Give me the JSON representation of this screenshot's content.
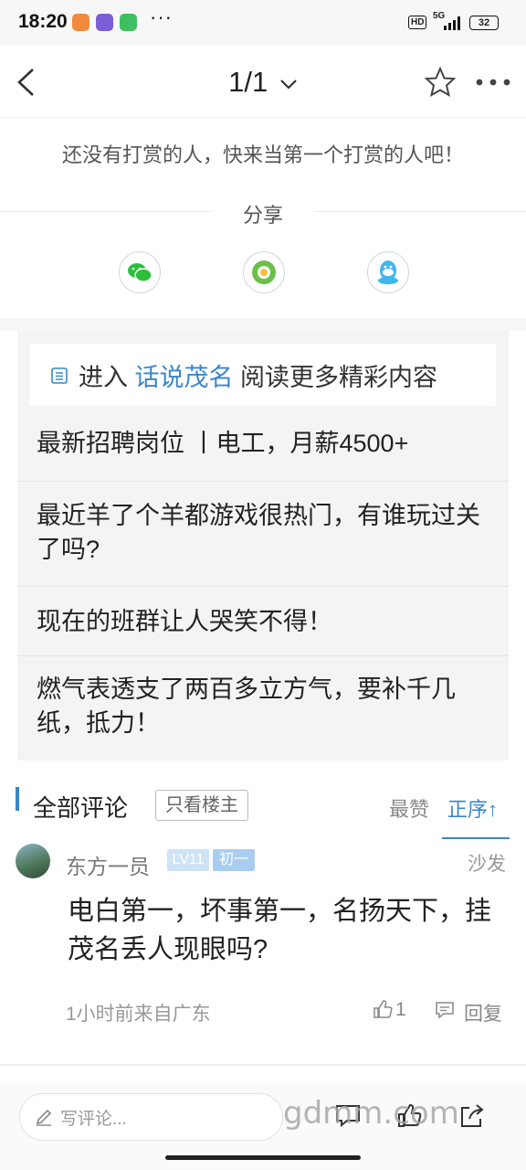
{
  "status_bar": {
    "time": "18:20",
    "more": "···",
    "hd": "HD",
    "network": "5G",
    "battery": "32"
  },
  "nav": {
    "page_indicator": "1/1"
  },
  "reward": {
    "text": "还没有打赏的人，快来当第一个打赏的人吧！"
  },
  "share": {
    "label": "分享",
    "targets": [
      "wechat-icon",
      "moments-icon",
      "qq-icon"
    ]
  },
  "related": {
    "enter_prefix": "进入",
    "forum_name": "话说茂名",
    "enter_suffix": "阅读更多精彩内容",
    "items": [
      "最新招聘岗位 丨电工，月薪4500+",
      "最近羊了个羊都游戏很热门，有谁玩过关了吗?",
      "现在的班群让人哭笑不得！",
      "燃气表透支了两百多立方气，要补千几纸，抵力！"
    ]
  },
  "comments": {
    "title": "全部评论",
    "owner_only": "只看楼主",
    "sort_like": "最赞",
    "sort_order": "正序↑",
    "items": [
      {
        "username": "东方一员",
        "level": "LV11",
        "grade": "初一",
        "floor": "沙发",
        "body": "电白第一，坏事第一，名扬天下，挂茂名丢人现眼吗?",
        "meta": "1小时前来自广东",
        "likes": "1",
        "reply": "回复"
      }
    ]
  },
  "bottom_bar": {
    "comment_placeholder": "写评论...",
    "watermark": "gdmm.com"
  },
  "colors": {
    "accent": "#3a86c8",
    "share_wechat": "#2bbf3a",
    "share_moments": "#6cc04a",
    "share_qq": "#3fb6f0"
  }
}
